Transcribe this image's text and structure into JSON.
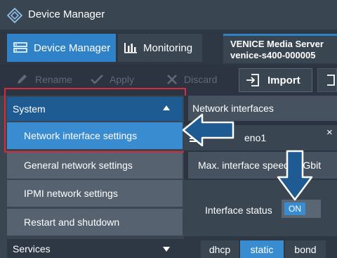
{
  "app": {
    "title": "Device Manager"
  },
  "nav": {
    "tabs": [
      {
        "label": "Device Manager",
        "icon": "device-manager-icon",
        "active": true
      },
      {
        "label": "Monitoring",
        "icon": "bar-chart-icon",
        "active": false
      }
    ],
    "server": {
      "name": "VENICE Media Server",
      "id": "venice-s400-000005"
    }
  },
  "toolbar": {
    "rename": "Rename",
    "apply": "Apply",
    "discard": "Discard",
    "import": "Import"
  },
  "sidebar": {
    "system": "System",
    "items": [
      "Network interface settings",
      "General network settings",
      "IPMI network settings",
      "Restart and shutdown"
    ],
    "services": "Services"
  },
  "panel": {
    "section": "Network interfaces",
    "interface": "eno1",
    "close": "×",
    "max_speed": "Max. interface speed 10Gbit",
    "status_label": "Interface status",
    "status_value": "ON",
    "modes": [
      "dhcp",
      "static",
      "bond"
    ],
    "selected_mode": "static"
  },
  "colors": {
    "accent": "#2f82c8",
    "highlight_border": "#d62b3d",
    "callout_arrow": "#1f5b93"
  }
}
